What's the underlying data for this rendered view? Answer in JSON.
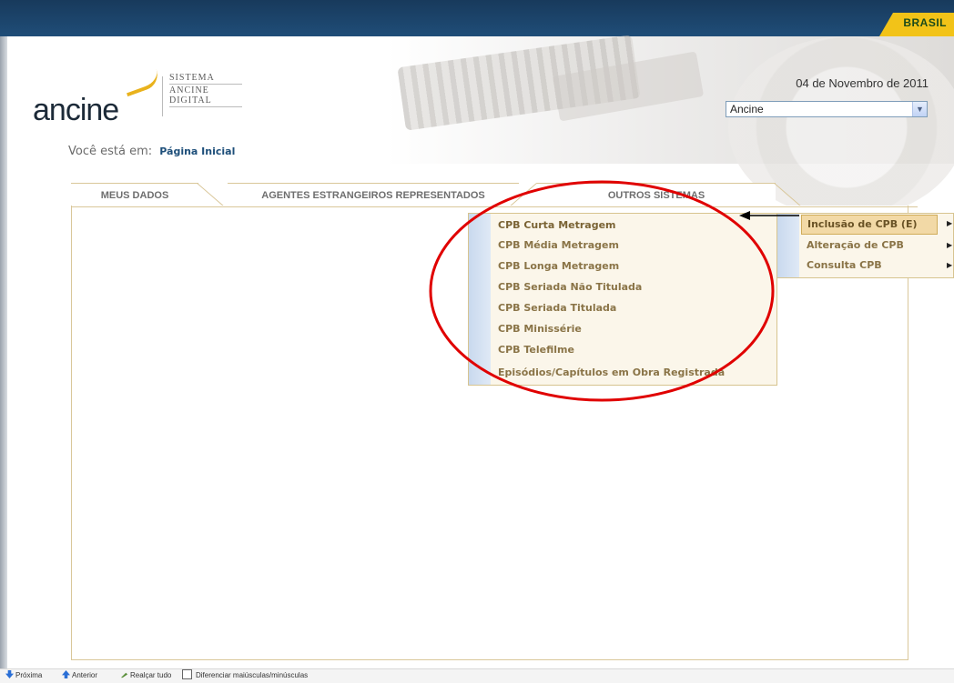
{
  "header": {
    "brand_flag": "BRASIL",
    "logo_word": "ancine",
    "logo_system_lines": [
      "SISTEMA",
      "ANCINE",
      "DIGITAL"
    ],
    "date": "04 de Novembro de 2011",
    "agent_select": {
      "value": "Ancine"
    }
  },
  "breadcrumb": {
    "label": "Você está em:",
    "current": "Página Inicial"
  },
  "tabs": [
    {
      "label": "MEUS DADOS"
    },
    {
      "label": "AGENTES ESTRANGEIROS REPRESENTADOS"
    },
    {
      "label": "OUTROS SISTEMAS"
    }
  ],
  "outros_menu": {
    "items": [
      "CPB Curta Metragem",
      "CPB Média Metragem",
      "CPB Longa Metragem",
      "CPB Seriada Não Titulada",
      "CPB Seriada Titulada",
      "CPB Minissérie",
      "CPB Telefilme",
      "Episódios/Capítulos em Obra Registrada"
    ]
  },
  "submenu": {
    "items": [
      {
        "label": "Inclusão de CPB (E)",
        "highlighted": true
      },
      {
        "label": "Alteração de CPB",
        "highlighted": false
      },
      {
        "label": "Consulta CPB",
        "highlighted": false
      }
    ]
  },
  "findbar": {
    "next": "Próxima",
    "previous": "Anterior",
    "highlight_all": "Realçar tudo",
    "match_case": "Diferenciar maiúsculas/minúsculas"
  },
  "colors": {
    "top_bar": "#1f4d78",
    "brand_flag": "#f2c318",
    "menu_text": "#8a7447",
    "annotation_ellipse": "#e00000"
  }
}
